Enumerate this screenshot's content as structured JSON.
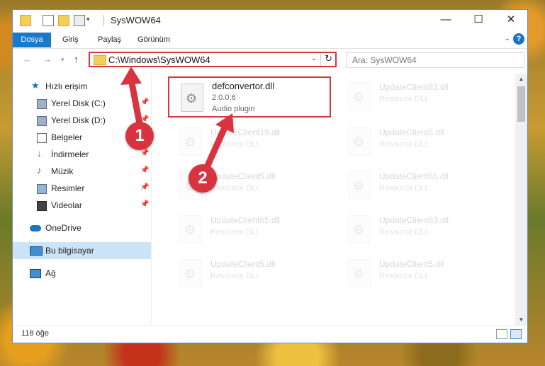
{
  "window": {
    "title": "SysWOW64",
    "controls": {
      "minimize": "—",
      "maximize": "☐",
      "close": "✕"
    }
  },
  "ribbon": {
    "tabs": [
      "Dosya",
      "Giriş",
      "Paylaş",
      "Görünüm"
    ],
    "help_label": "?"
  },
  "address": {
    "path": "C:\\Windows\\SysWOW64",
    "search_placeholder": "Ara: SysWOW64"
  },
  "nav": {
    "items": [
      {
        "label": "Hızlı erişim",
        "icon": "star-icon"
      },
      {
        "label": "Yerel Disk (C:)",
        "icon": "drive-icon"
      },
      {
        "label": "Yerel Disk (D:)",
        "icon": "drive-icon"
      },
      {
        "label": "Belgeler",
        "icon": "documents-icon"
      },
      {
        "label": "İndirmeler",
        "icon": "download-icon"
      },
      {
        "label": "Müzik",
        "icon": "music-icon"
      },
      {
        "label": "Resimler",
        "icon": "pictures-icon"
      },
      {
        "label": "Videolar",
        "icon": "video-icon"
      },
      {
        "label": "OneDrive",
        "icon": "cloud-icon"
      },
      {
        "label": "Bu bilgisayar",
        "icon": "computer-icon"
      },
      {
        "label": "Ağ",
        "icon": "network-icon"
      }
    ]
  },
  "files": [
    {
      "name": "defconvertor.dll",
      "version": "2.0.0.6",
      "desc": "Audio plugin"
    },
    {
      "name": "UpdateClient63.dll",
      "desc": "Resource DLL"
    },
    {
      "name": "UpdateClient19.dll",
      "desc": "Resource DLL"
    },
    {
      "name": "UpdateClient5.dll",
      "desc": "Resource DLL"
    },
    {
      "name": "UpdateClient5.dll",
      "desc": "Resource DLL"
    },
    {
      "name": "UpdateClient65.dll",
      "desc": "Resource DLL"
    },
    {
      "name": "UpdateClient65.dll",
      "desc": "Resource DLL"
    },
    {
      "name": "UpdateClient63.dll",
      "desc": "Resource DLL"
    },
    {
      "name": "UpdateClient5.dll",
      "desc": "Resource DLL"
    },
    {
      "name": "UpdateClient5.dll",
      "desc": "Resource DLL"
    }
  ],
  "status": {
    "count": "118 öğe"
  },
  "callouts": [
    "1",
    "2"
  ],
  "colors": {
    "accent": "#1979ca",
    "highlight": "#d9333f",
    "selected_nav": "#cce4f7"
  }
}
